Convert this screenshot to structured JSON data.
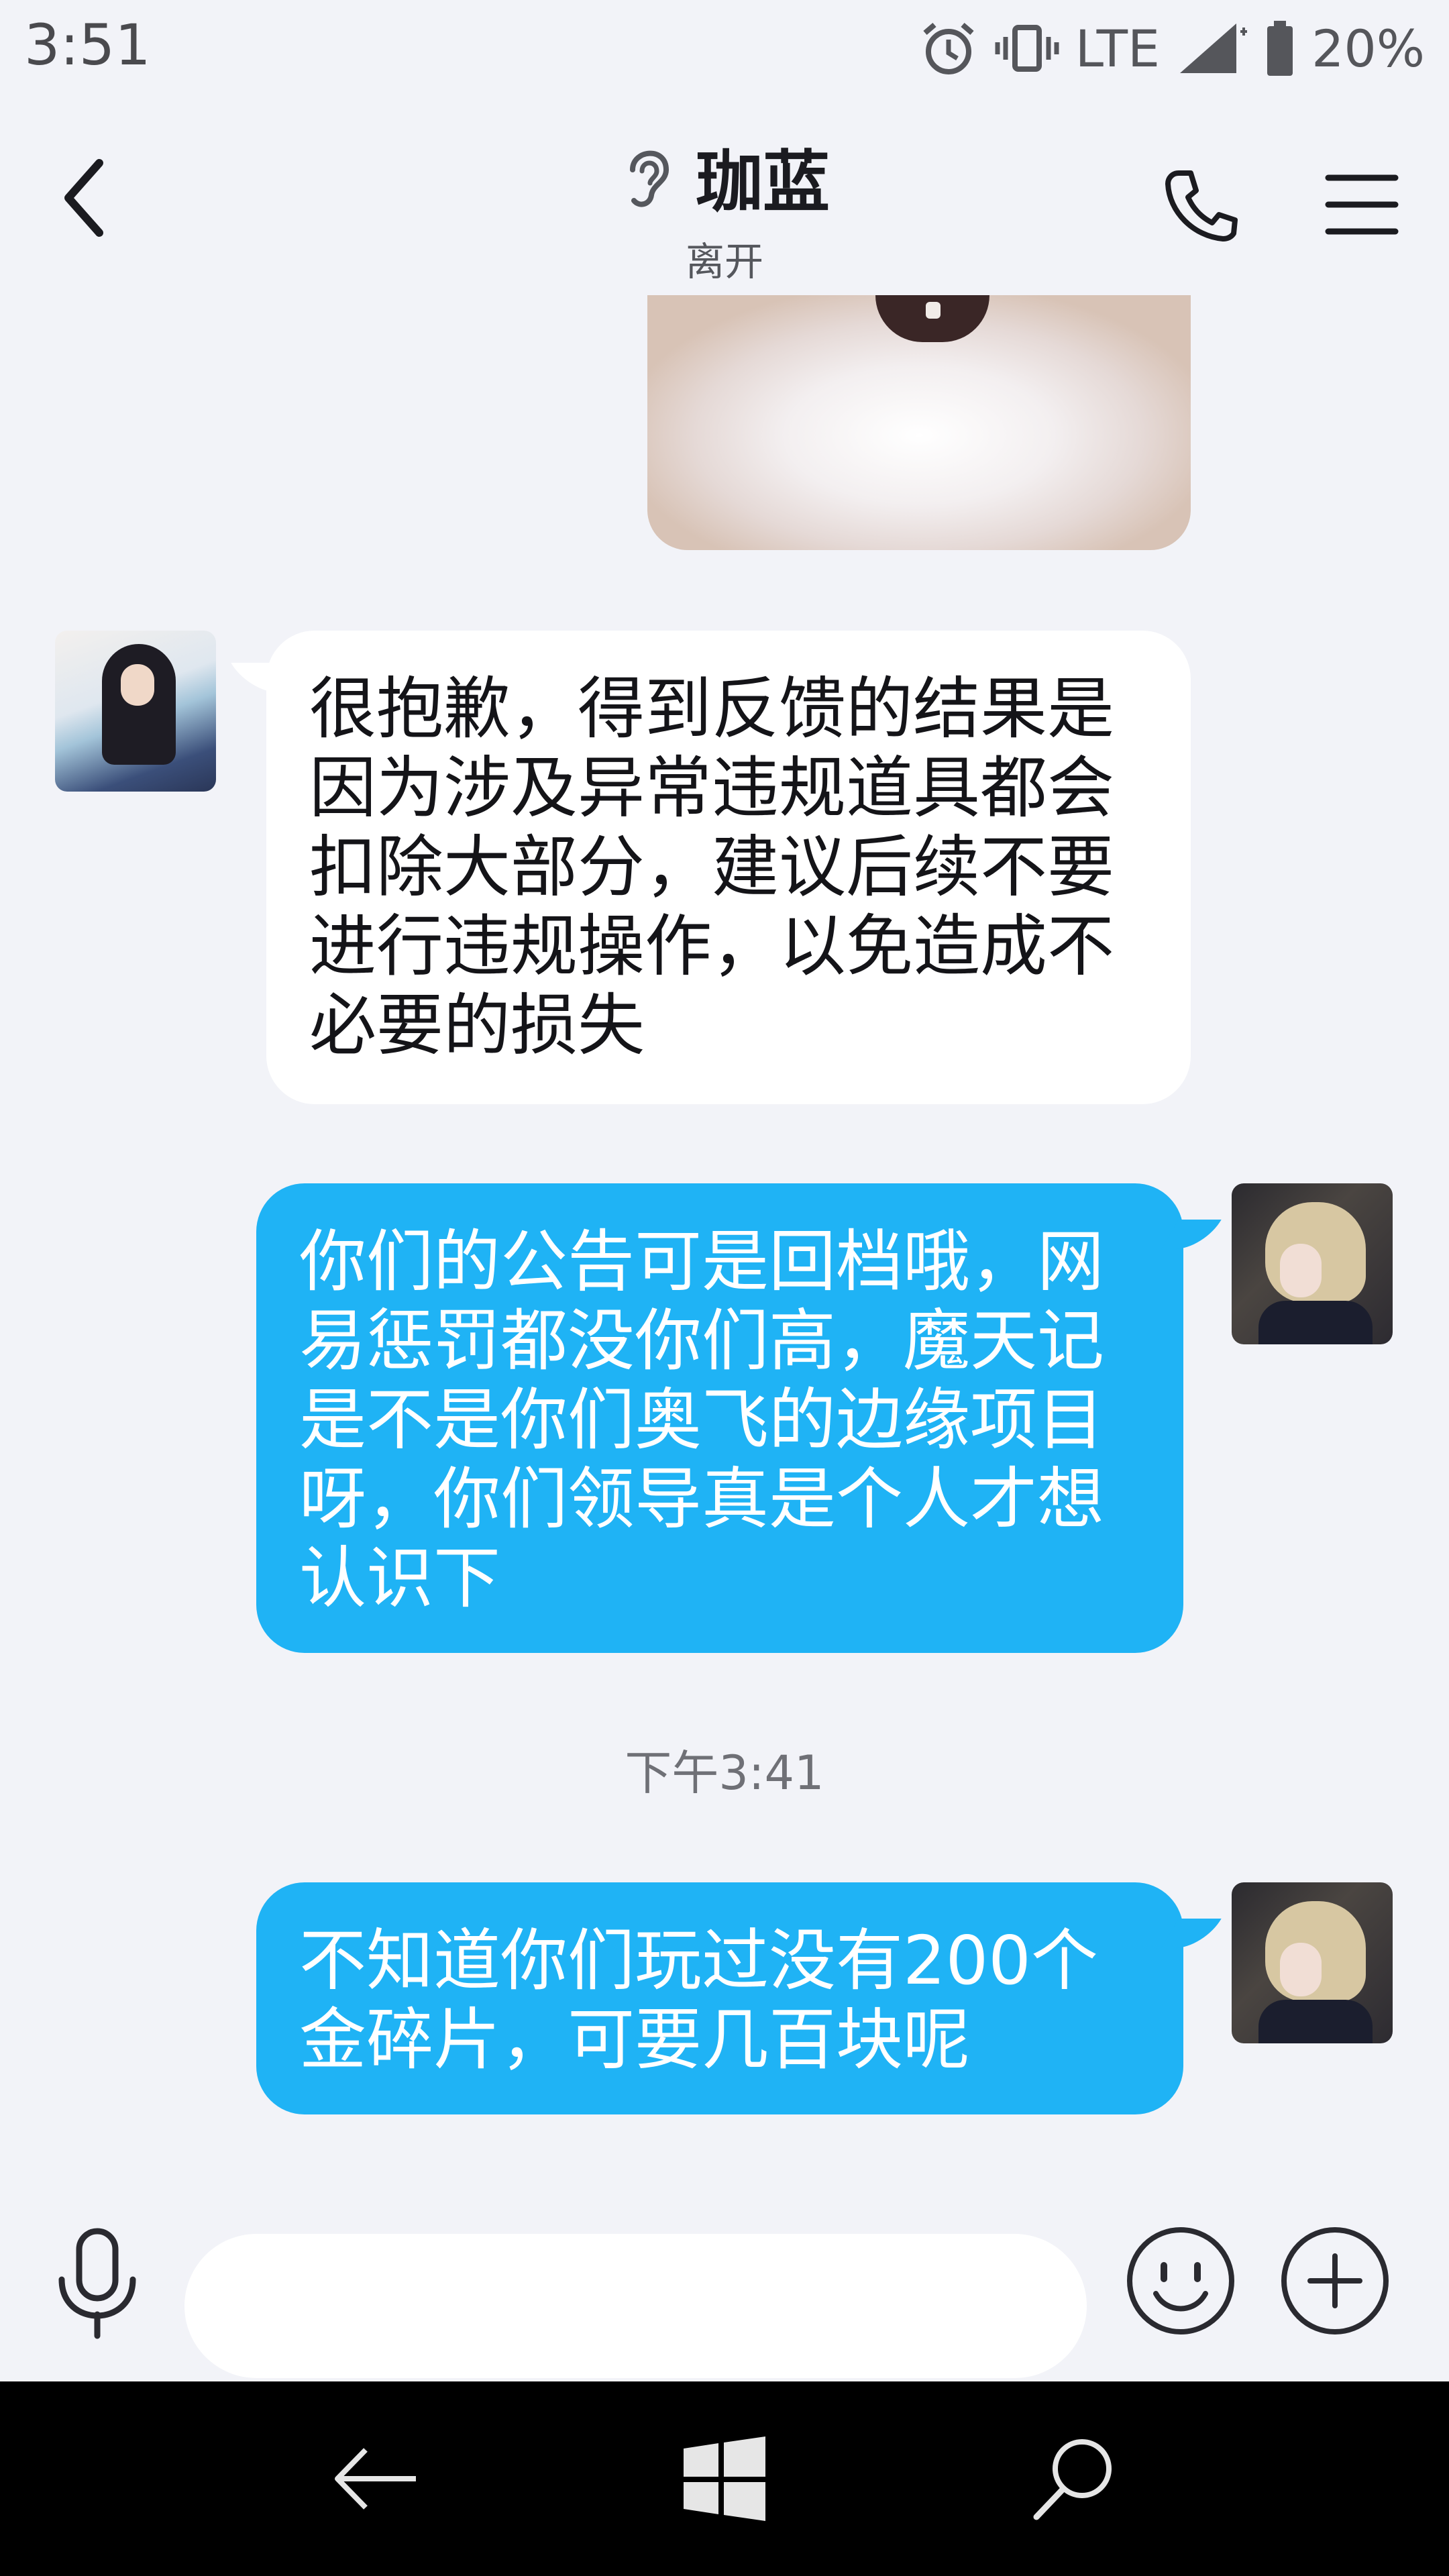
{
  "status_bar": {
    "time": "3:51",
    "network": "LTE",
    "battery": "20%",
    "icons": [
      "alarm-icon",
      "vibrate-icon",
      "signal-icon",
      "battery-icon"
    ]
  },
  "header": {
    "title": "珈蓝",
    "subtitle": "离开",
    "icons": [
      "back-icon",
      "ear-icon",
      "phone-icon",
      "menu-icon"
    ]
  },
  "messages": [
    {
      "side": "left",
      "text": "很抱歉，得到反馈的结果是\n因为涉及异常违规道具都会\n扣除大部分，建议后续不要\n进行违规操作，以免造成不\n必要的损失"
    },
    {
      "side": "right",
      "text": "你们的公告可是回档哦，网\n易惩罚都没你们高，魔天记\n是不是你们奥飞的边缘项目\n呀，你们领导真是个人才想\n认识下"
    },
    {
      "side": "right",
      "text": "不知道你们玩过没有200个\n金碎片，可要几百块呢"
    }
  ],
  "timestamp": "下午3:41",
  "input_bar": {
    "value": "",
    "icons": [
      "microphone-icon",
      "emoji-icon",
      "plus-icon"
    ]
  },
  "nav_bar": {
    "icons": [
      "nav-back-icon",
      "windows-home-icon",
      "nav-search-icon"
    ]
  },
  "colors": {
    "outgoing_bubble": "#1fb3f5",
    "incoming_bubble": "#ffffff",
    "background": "#f2f3f8",
    "nav_bar": "#000000"
  }
}
